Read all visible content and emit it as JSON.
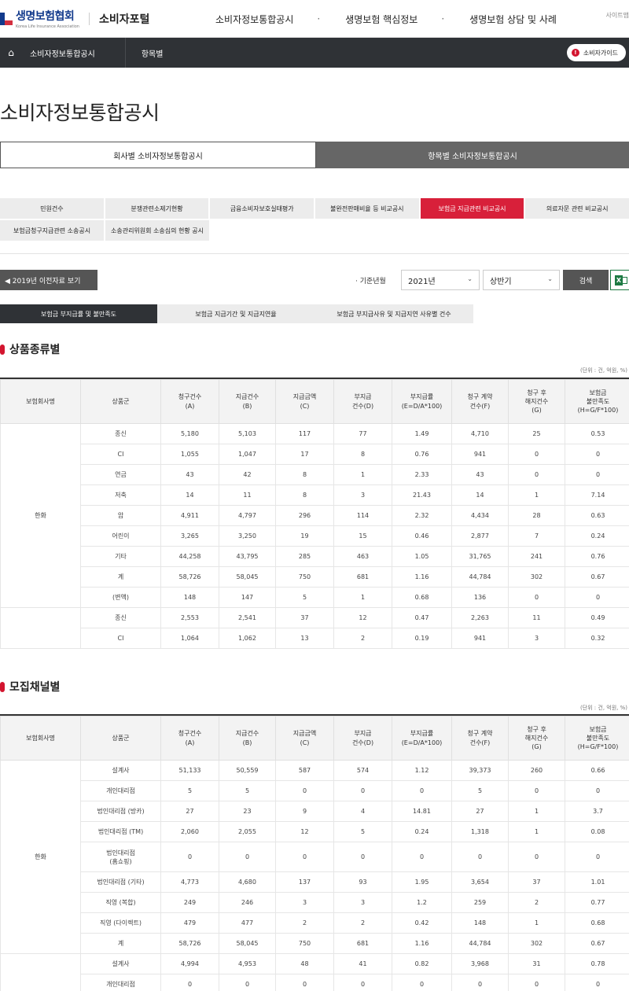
{
  "header": {
    "logo_name": "생명보험협회",
    "logo_sub": "Korea Life Insurance Association",
    "portal": "소비자포털",
    "nav": [
      "소비자정보통합공시",
      "생명보험 핵심정보",
      "생명보험 상담 및 사례"
    ],
    "nav_dot": "·",
    "sitemap": "사이트맵"
  },
  "navbar": {
    "home_icon": "home-icon",
    "crumb1": "소비자정보통합공시",
    "crumb2": "항목별",
    "guide_icon_text": "!",
    "guide": "소비자가이드"
  },
  "page_title": "소비자정보통합공시",
  "main_tabs": [
    "회사별 소비자정보통합공시",
    "항목별 소비자정보통합공시"
  ],
  "sub_tabs": [
    [
      "민원건수",
      "분쟁관련소제기현황",
      "금융소비자보호실태평가",
      "불완전판매비율 등 비교공시",
      "보험금 지급관련 비교공시",
      "의료자문 관련 비교공시"
    ],
    [
      "보험금청구지급관련 소송공시",
      "소송관리위원회 소송심의 현황 공시"
    ]
  ],
  "filter": {
    "prev_button": "◀ 2019년 이전자료 보기",
    "label": "· 기준년월",
    "year": "2021년",
    "half": "상반기",
    "chevron": "⌄",
    "search": "검색",
    "excel_letter": "X"
  },
  "pill_tabs": [
    "보험금 부지급률 및 불만족도",
    "보험금 지급기간 및 지급지연율",
    "보험금 부지급사유 및 지급지연 사유별 건수"
  ],
  "unit_text": "(단위 : 건, 억원, %)",
  "table_headers": [
    [
      "보험회사명"
    ],
    [
      "상품군"
    ],
    [
      "청구건수",
      "(A)"
    ],
    [
      "지급건수",
      "(B)"
    ],
    [
      "지급금액",
      "(C)"
    ],
    [
      "부지급",
      "건수(D)"
    ],
    [
      "부지급률",
      "(E=D/A*100)"
    ],
    [
      "청구 계약",
      "건수(F)"
    ],
    [
      "청구 후",
      "해지건수",
      "(G)"
    ],
    [
      "보험금",
      "불만족도",
      "(H=G/F*100)"
    ]
  ],
  "section1": {
    "title": "상품종류별",
    "company": "한화",
    "rows": [
      [
        "종신",
        "5,180",
        "5,103",
        "117",
        "77",
        "1.49",
        "4,710",
        "25",
        "0.53"
      ],
      [
        "CI",
        "1,055",
        "1,047",
        "17",
        "8",
        "0.76",
        "941",
        "0",
        "0"
      ],
      [
        "연금",
        "43",
        "42",
        "8",
        "1",
        "2.33",
        "43",
        "0",
        "0"
      ],
      [
        "저축",
        "14",
        "11",
        "8",
        "3",
        "21.43",
        "14",
        "1",
        "7.14"
      ],
      [
        "암",
        "4,911",
        "4,797",
        "296",
        "114",
        "2.32",
        "4,434",
        "28",
        "0.63"
      ],
      [
        "어린이",
        "3,265",
        "3,250",
        "19",
        "15",
        "0.46",
        "2,877",
        "7",
        "0.24"
      ],
      [
        "기타",
        "44,258",
        "43,795",
        "285",
        "463",
        "1.05",
        "31,765",
        "241",
        "0.76"
      ],
      [
        "계",
        "58,726",
        "58,045",
        "750",
        "681",
        "1.16",
        "44,784",
        "302",
        "0.67"
      ],
      [
        "(변액)",
        "148",
        "147",
        "5",
        "1",
        "0.68",
        "136",
        "0",
        "0"
      ]
    ],
    "next_rows": [
      [
        "종신",
        "2,553",
        "2,541",
        "37",
        "12",
        "0.47",
        "2,263",
        "11",
        "0.49"
      ],
      [
        "CI",
        "1,064",
        "1,062",
        "13",
        "2",
        "0.19",
        "941",
        "3",
        "0.32"
      ]
    ]
  },
  "section2": {
    "title": "모집채널별",
    "company": "한화",
    "rows": [
      [
        "설계사",
        "51,133",
        "50,559",
        "587",
        "574",
        "1.12",
        "39,373",
        "260",
        "0.66"
      ],
      [
        "개인대리점",
        "5",
        "5",
        "0",
        "0",
        "0",
        "5",
        "0",
        "0"
      ],
      [
        "법인대리점 (방카)",
        "27",
        "23",
        "9",
        "4",
        "14.81",
        "27",
        "1",
        "3.7"
      ],
      [
        "법인대리점 (TM)",
        "2,060",
        "2,055",
        "12",
        "5",
        "0.24",
        "1,318",
        "1",
        "0.08"
      ],
      [
        "법인대리점\n(홈쇼핑)",
        "0",
        "0",
        "0",
        "0",
        "0",
        "0",
        "0",
        "0"
      ],
      [
        "법인대리점 (기타)",
        "4,773",
        "4,680",
        "137",
        "93",
        "1.95",
        "3,654",
        "37",
        "1.01"
      ],
      [
        "직영 (복합)",
        "249",
        "246",
        "3",
        "3",
        "1.2",
        "259",
        "2",
        "0.77"
      ],
      [
        "직영 (다이렉트)",
        "479",
        "477",
        "2",
        "2",
        "0.42",
        "148",
        "1",
        "0.68"
      ],
      [
        "계",
        "58,726",
        "58,045",
        "750",
        "681",
        "1.16",
        "44,784",
        "302",
        "0.67"
      ]
    ],
    "next_rows": [
      [
        "설계사",
        "4,994",
        "4,953",
        "48",
        "41",
        "0.82",
        "3,968",
        "31",
        "0.78"
      ],
      [
        "개인대리점",
        "0",
        "0",
        "0",
        "0",
        "0",
        "0",
        "0",
        "0"
      ]
    ]
  },
  "colors": {
    "accent": "#d8203a",
    "dark": "#2f3236",
    "brand": "#123a8c"
  }
}
